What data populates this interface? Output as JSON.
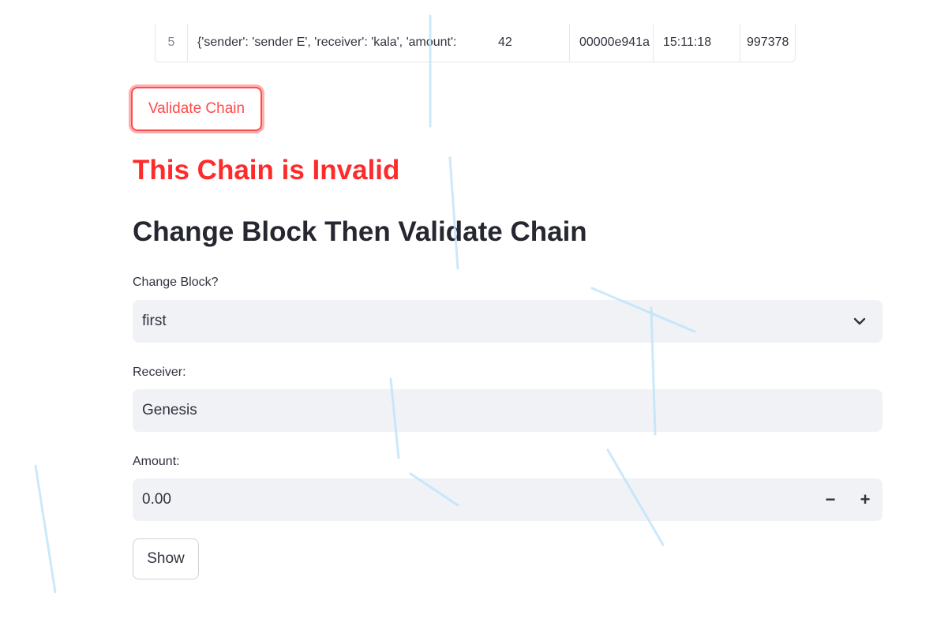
{
  "table": {
    "row": {
      "index": "5",
      "data": "{'sender': 'sender E', 'receiver': 'kala', 'amount':",
      "amount": "42",
      "hash": "00000e941a",
      "time": "15:11:18",
      "nonce": "997378"
    }
  },
  "validate_label": "Validate Chain",
  "invalid_message": "This Chain is Invalid",
  "section_title": "Change Block Then Validate Chain",
  "change_block": {
    "label": "Change Block?",
    "selected": "first"
  },
  "receiver": {
    "label": "Receiver:",
    "value": "Genesis"
  },
  "amount": {
    "label": "Amount:",
    "value": "0.00",
    "minus": "−",
    "plus": "+"
  },
  "show_label": "Show",
  "colors": {
    "accent": "#ff4b4b",
    "invalid": "#ff2b2b",
    "field_bg": "#f0f2f6",
    "snowflake": "#a8dcfb"
  },
  "icons": {
    "select": "chevron-down-icon",
    "decor": "snowflake-icon"
  }
}
